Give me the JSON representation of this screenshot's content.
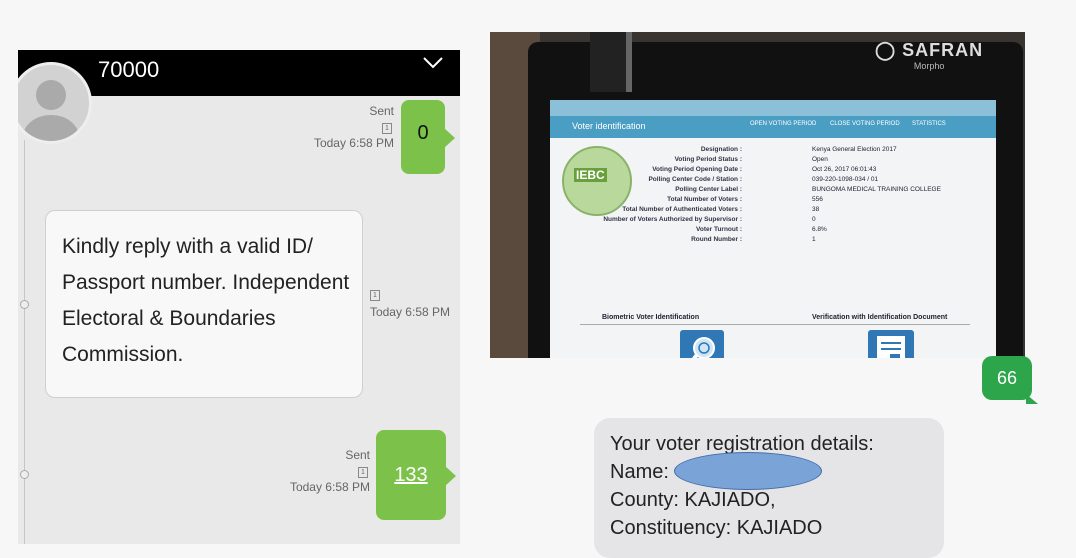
{
  "left": {
    "contact": "70000",
    "messages": [
      {
        "status": "Sent",
        "sim": "1",
        "time": "Today 6:58 PM",
        "text": "0"
      },
      {
        "sim": "1",
        "time": "Today 6:58 PM",
        "text": "Kindly reply with a valid ID/ Passport number. Independent Electoral & Boundaries Commission."
      },
      {
        "status": "Sent",
        "sim": "1",
        "time": "Today 6:58 PM",
        "text": "133"
      }
    ]
  },
  "device": {
    "brand": "SAFRAN",
    "brand_sub": "Morpho",
    "screen_title": "Voter identification",
    "buttons": [
      "OPEN VOTING PERIOD",
      "CLOSE VOTING PERIOD",
      "STATISTICS"
    ],
    "logo_text": "IEBC",
    "rows": [
      {
        "label": "Designation :",
        "value": "Kenya General Election 2017"
      },
      {
        "label": "Voting Period Status :",
        "value": "Open"
      },
      {
        "label": "Voting Period Opening Date :",
        "value": "Oct 26, 2017 06:01:43"
      },
      {
        "label": "Polling Center Code / Station :",
        "value": "039-220-1098-034 / 01"
      },
      {
        "label": "Polling Center Label :",
        "value": "BUNGOMA MEDICAL TRAINING COLLEGE"
      },
      {
        "label": "Total Number of Voters :",
        "value": "556"
      },
      {
        "label": "Total Number of Authenticated Voters :",
        "value": "38"
      },
      {
        "label": "Number of Voters Authorized by Supervisor :",
        "value": "0"
      },
      {
        "label": "Voter Turnout :",
        "value": "6.8%"
      },
      {
        "label": "Round Number :",
        "value": "1"
      }
    ],
    "biometric_label": "Biometric Voter Identification",
    "document_label": "Verification with Identification Document"
  },
  "right": {
    "badge": "66",
    "details": {
      "line1": "Your voter registration details:",
      "line2": "Name:",
      "line3": "County: KAJIADO,",
      "line4": "Constituency: KAJIADO"
    }
  },
  "colors": {
    "sent_green": "#7cc24a",
    "badge_green": "#2da54a",
    "header_black": "#000000",
    "redaction_blue": "#7aa4d8"
  }
}
